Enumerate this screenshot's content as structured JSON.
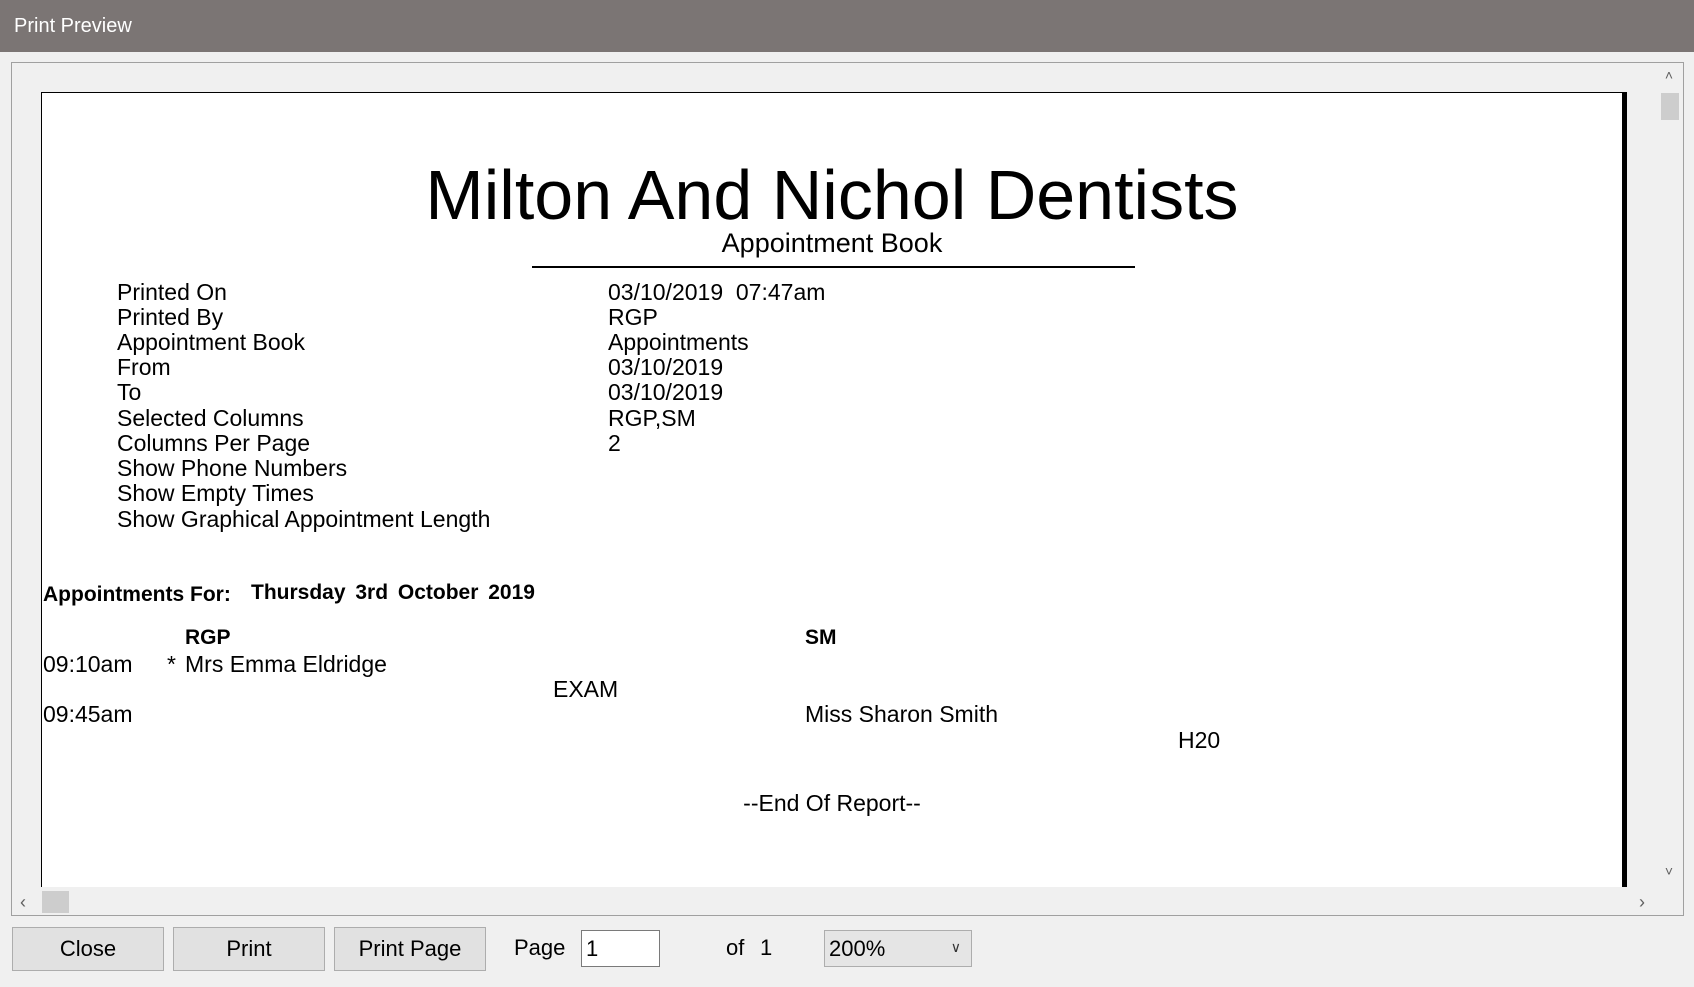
{
  "window": {
    "title": "Print Preview"
  },
  "report": {
    "title": "Milton And Nichol Dentists",
    "subtitle": "Appointment Book",
    "info": [
      {
        "label": "Printed On",
        "value": "03/10/2019  07:47am"
      },
      {
        "label": "Printed By",
        "value": "RGP"
      },
      {
        "label": "Appointment Book",
        "value": "Appointments"
      },
      {
        "label": "From",
        "value": "03/10/2019"
      },
      {
        "label": "To",
        "value": "03/10/2019"
      },
      {
        "label": "Selected Columns",
        "value": "RGP,SM"
      },
      {
        "label": "Columns Per Page",
        "value": "2"
      },
      {
        "label": "Show Phone Numbers",
        "value": ""
      },
      {
        "label": "Show Empty Times",
        "value": ""
      },
      {
        "label": "Show Graphical Appointment Length",
        "value": ""
      }
    ],
    "section_label": "Appointments For:",
    "section_date": "Thursday 3rd October 2019",
    "columns": [
      "RGP",
      "SM"
    ],
    "appointments": [
      {
        "time": "09:10am",
        "marker": "*",
        "patient": "Mrs Emma Eldridge",
        "type": "EXAM"
      },
      {
        "time": "09:45am",
        "patient": "Miss Sharon Smith",
        "type": "H20"
      }
    ],
    "end": "--End Of Report--"
  },
  "footer": {
    "close": "Close",
    "print": "Print",
    "print_page": "Print Page",
    "page_label": "Page",
    "page_value": "1",
    "of_label": "of",
    "total_pages": "1",
    "zoom": "200%"
  }
}
